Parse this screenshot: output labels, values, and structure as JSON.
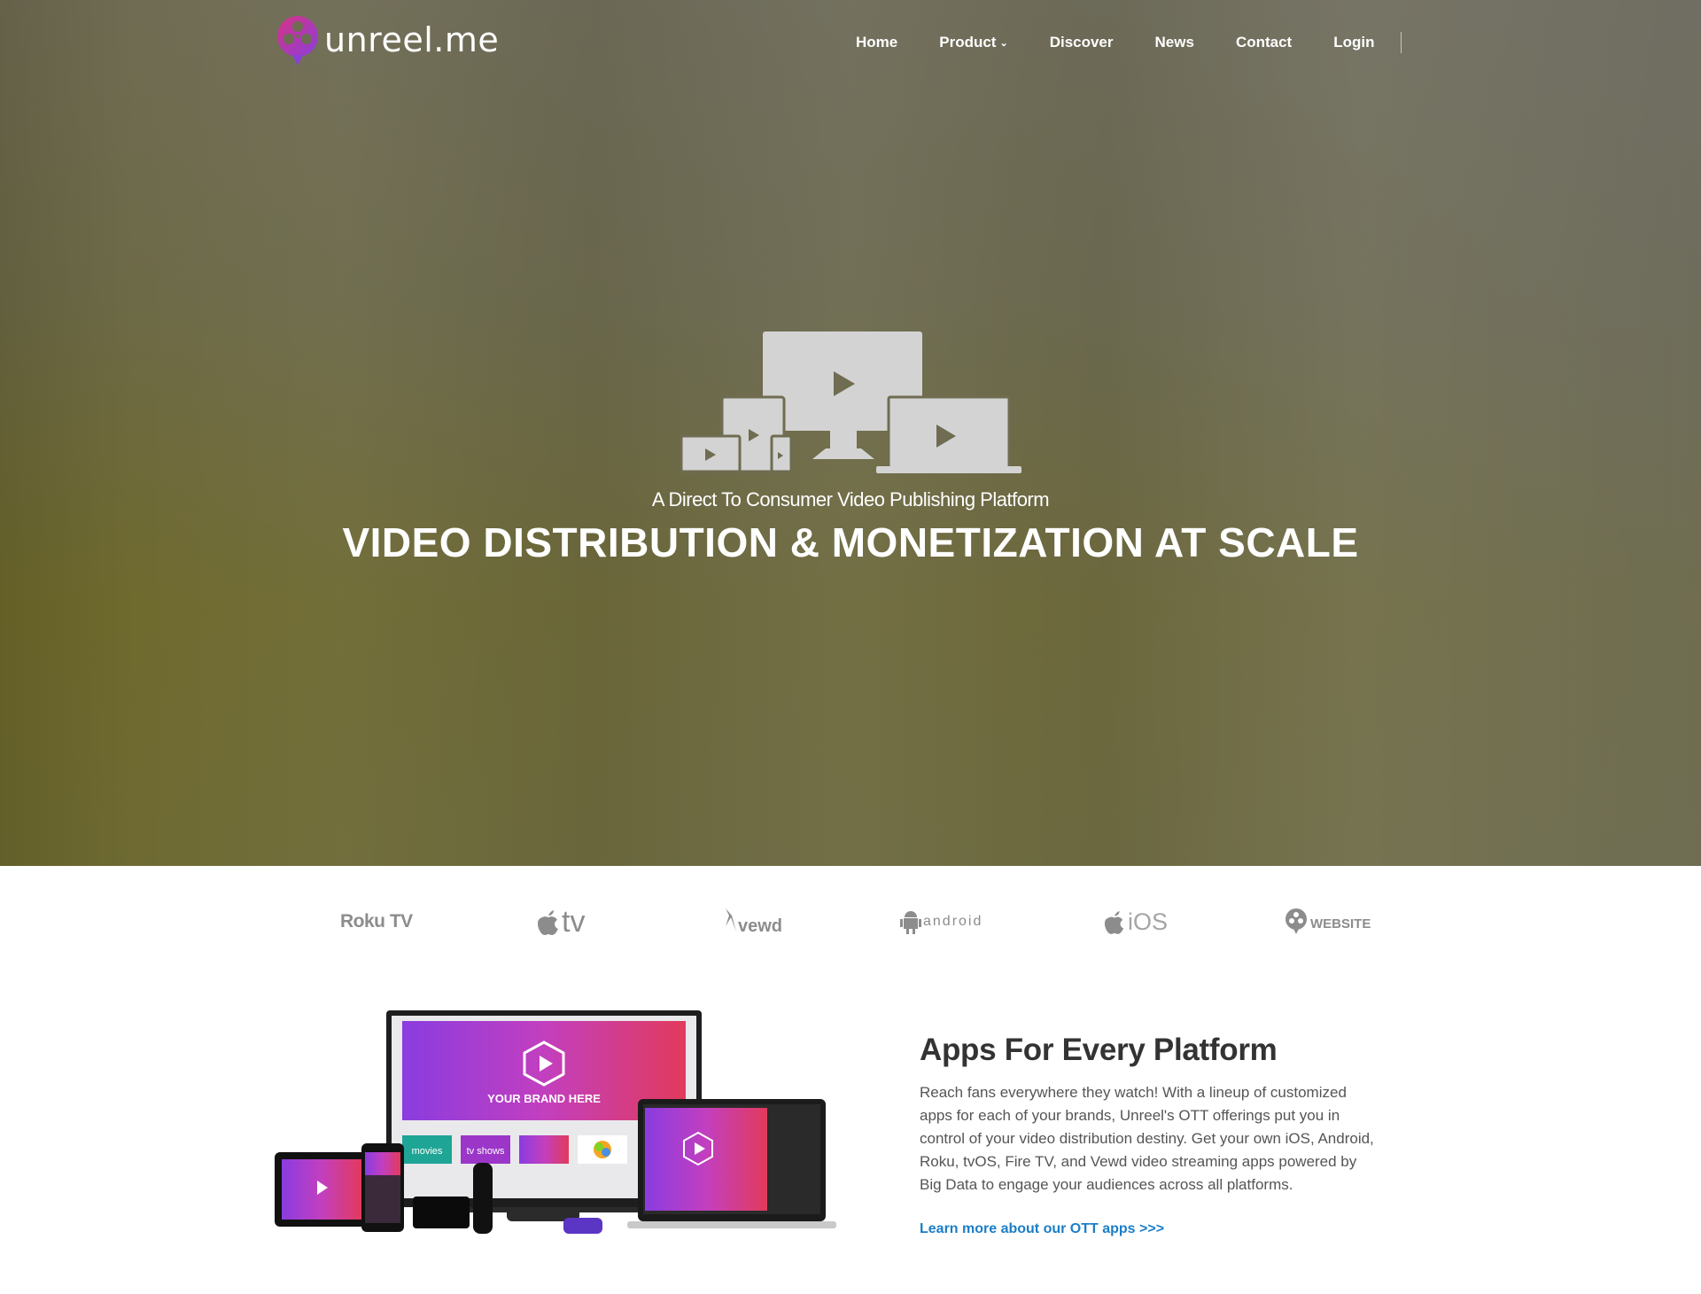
{
  "brand": {
    "name": "unreel.me",
    "logo_colors": [
      "#d63384",
      "#8b3fd9"
    ]
  },
  "nav": {
    "items": [
      {
        "label": "Home"
      },
      {
        "label": "Product"
      },
      {
        "label": "Discover"
      },
      {
        "label": "News"
      },
      {
        "label": "Contact"
      },
      {
        "label": "Login"
      }
    ]
  },
  "hero": {
    "subtitle": "A Direct To Consumer Video Publishing Platform",
    "headline": "VIDEO DISTRIBUTION & MONETIZATION AT SCALE"
  },
  "platforms": [
    {
      "label": "Roku TV",
      "icon": "roku-tv-logo"
    },
    {
      "label": "tv",
      "icon": "apple-tv-logo"
    },
    {
      "label": "vewd",
      "icon": "vewd-logo"
    },
    {
      "label": "android",
      "icon": "android-logo"
    },
    {
      "label": "iOS",
      "icon": "apple-ios-logo"
    },
    {
      "label": "WEBSITE",
      "icon": "website-logo"
    }
  ],
  "feature": {
    "title": "Apps For Every Platform",
    "body": "Reach fans everywhere they watch! With a lineup of customized apps for each of your brands, Unreel's OTT offerings put you in control of your video distribution destiny. Get your own iOS, Android, Roku, tvOS, Fire TV, and Vewd video streaming apps powered by Big Data to engage your audiences across all platforms.",
    "link": "Learn more about our OTT apps >>>",
    "image_texts": {
      "brand": "YOUR BRAND HERE",
      "tile_movies": "movies",
      "tile_tvshows": "tv shows"
    }
  },
  "colors": {
    "link": "#1a7ec8",
    "hero_text": "#ffffff",
    "platform_gray": "#8c8c8c"
  }
}
